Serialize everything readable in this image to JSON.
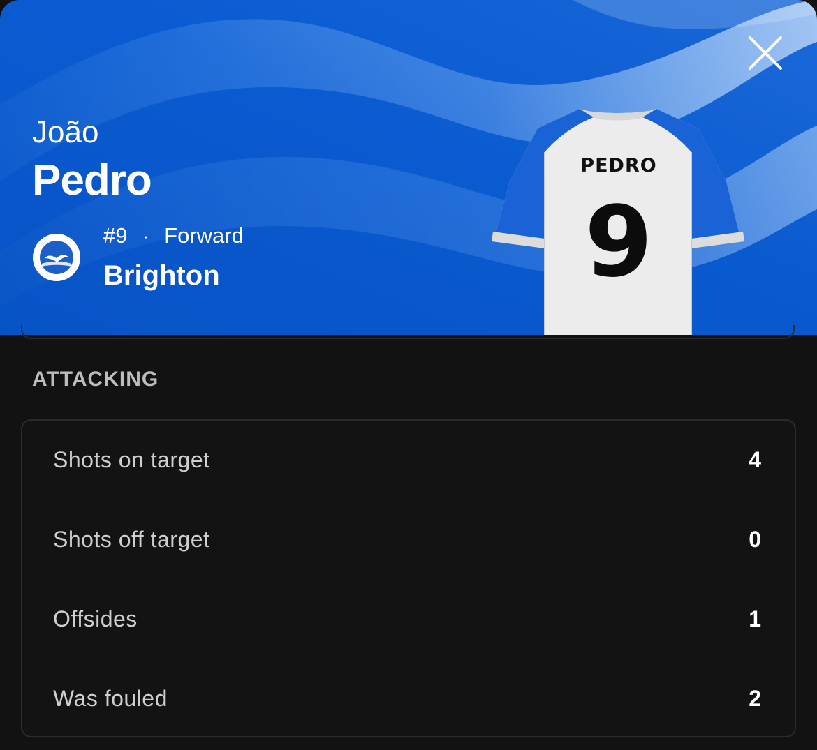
{
  "colors": {
    "hero_blue": "#0a5bd0",
    "background": "#121212",
    "card_border": "#2c2c2c",
    "label_grey": "#cfcfcf",
    "section_grey": "#bdbdbd"
  },
  "player": {
    "first_name": "João",
    "last_name": "Pedro",
    "number": "#9",
    "separator": "·",
    "position": "Forward",
    "club": "Brighton",
    "club_badge_icon": "brighton-badge-icon",
    "shirt": {
      "name": "PEDRO",
      "number": "9"
    }
  },
  "header": {
    "close_icon": "close-icon"
  },
  "section": {
    "title": "ATTACKING"
  },
  "stats": [
    {
      "label": "Shots on target",
      "value": "4"
    },
    {
      "label": "Shots off target",
      "value": "0"
    },
    {
      "label": "Offsides",
      "value": "1"
    },
    {
      "label": "Was fouled",
      "value": "2"
    }
  ]
}
